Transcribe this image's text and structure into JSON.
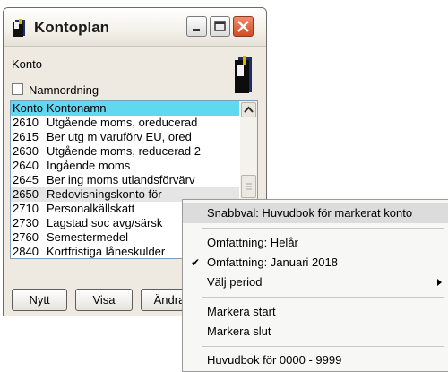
{
  "window": {
    "title": "Kontoplan",
    "konto_label": "Konto",
    "namnordning_label": "Namnordning"
  },
  "list": {
    "headers": [
      "Konto",
      "Kontonamn"
    ],
    "rows": [
      {
        "konto": "2610",
        "namn": "Utgående moms, oreducerad"
      },
      {
        "konto": "2615",
        "namn": "Ber utg m varuförv EU, ored"
      },
      {
        "konto": "2630",
        "namn": "Utgående moms, reducerad 2"
      },
      {
        "konto": "2640",
        "namn": "Ingående moms"
      },
      {
        "konto": "2645",
        "namn": "Ber ing moms utlandsförvärv"
      },
      {
        "konto": "2650",
        "namn": "Redovisningskonto för"
      },
      {
        "konto": "2710",
        "namn": "Personalkällskatt"
      },
      {
        "konto": "2730",
        "namn": "Lagstad soc avg/särsk"
      },
      {
        "konto": "2760",
        "namn": "Semestermedel"
      },
      {
        "konto": "2840",
        "namn": "Kortfristiga låneskulder"
      }
    ]
  },
  "buttons": {
    "nytt": "Nytt",
    "visa": "Visa",
    "andra": "Ändra"
  },
  "context_menu": {
    "snabbval": "Snabbval: Huvudbok för markerat konto",
    "omfattning_helar": "Omfattning: Helår",
    "omfattning_januari": "Omfattning: Januari 2018",
    "valj_period": "Välj period",
    "markera_start": "Markera start",
    "markera_slut": "Markera slut",
    "huvudbok_range": "Huvudbok för 0000 - 9999"
  },
  "colors": {
    "header_row": "#5fd9ef",
    "selected_row": "#e5e5e5",
    "close_button": "#d24b22"
  }
}
